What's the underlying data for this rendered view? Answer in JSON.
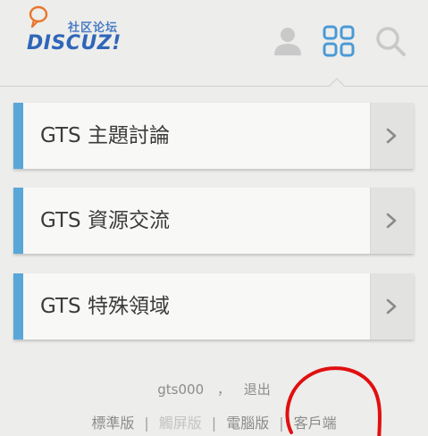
{
  "header": {
    "logo": {
      "cn_text": "社区论坛",
      "en_text": "DISCUZ!"
    },
    "icons": [
      "user-icon",
      "grid-icon",
      "search-icon"
    ]
  },
  "forums": [
    {
      "label": "GTS 主題討論"
    },
    {
      "label": "GTS 資源交流"
    },
    {
      "label": "GTS 特殊領域"
    }
  ],
  "footer": {
    "username": "gts000",
    "comma": "，",
    "logout": "退出",
    "links": [
      "標準版",
      "觸屏版",
      "電腦版",
      "客戶端"
    ],
    "separator": "|"
  },
  "colors": {
    "accent": "#59a6d8",
    "logo_blue": "#2f66b8",
    "icon_blue": "#4a9ad6",
    "annotation_red": "#e01010"
  }
}
